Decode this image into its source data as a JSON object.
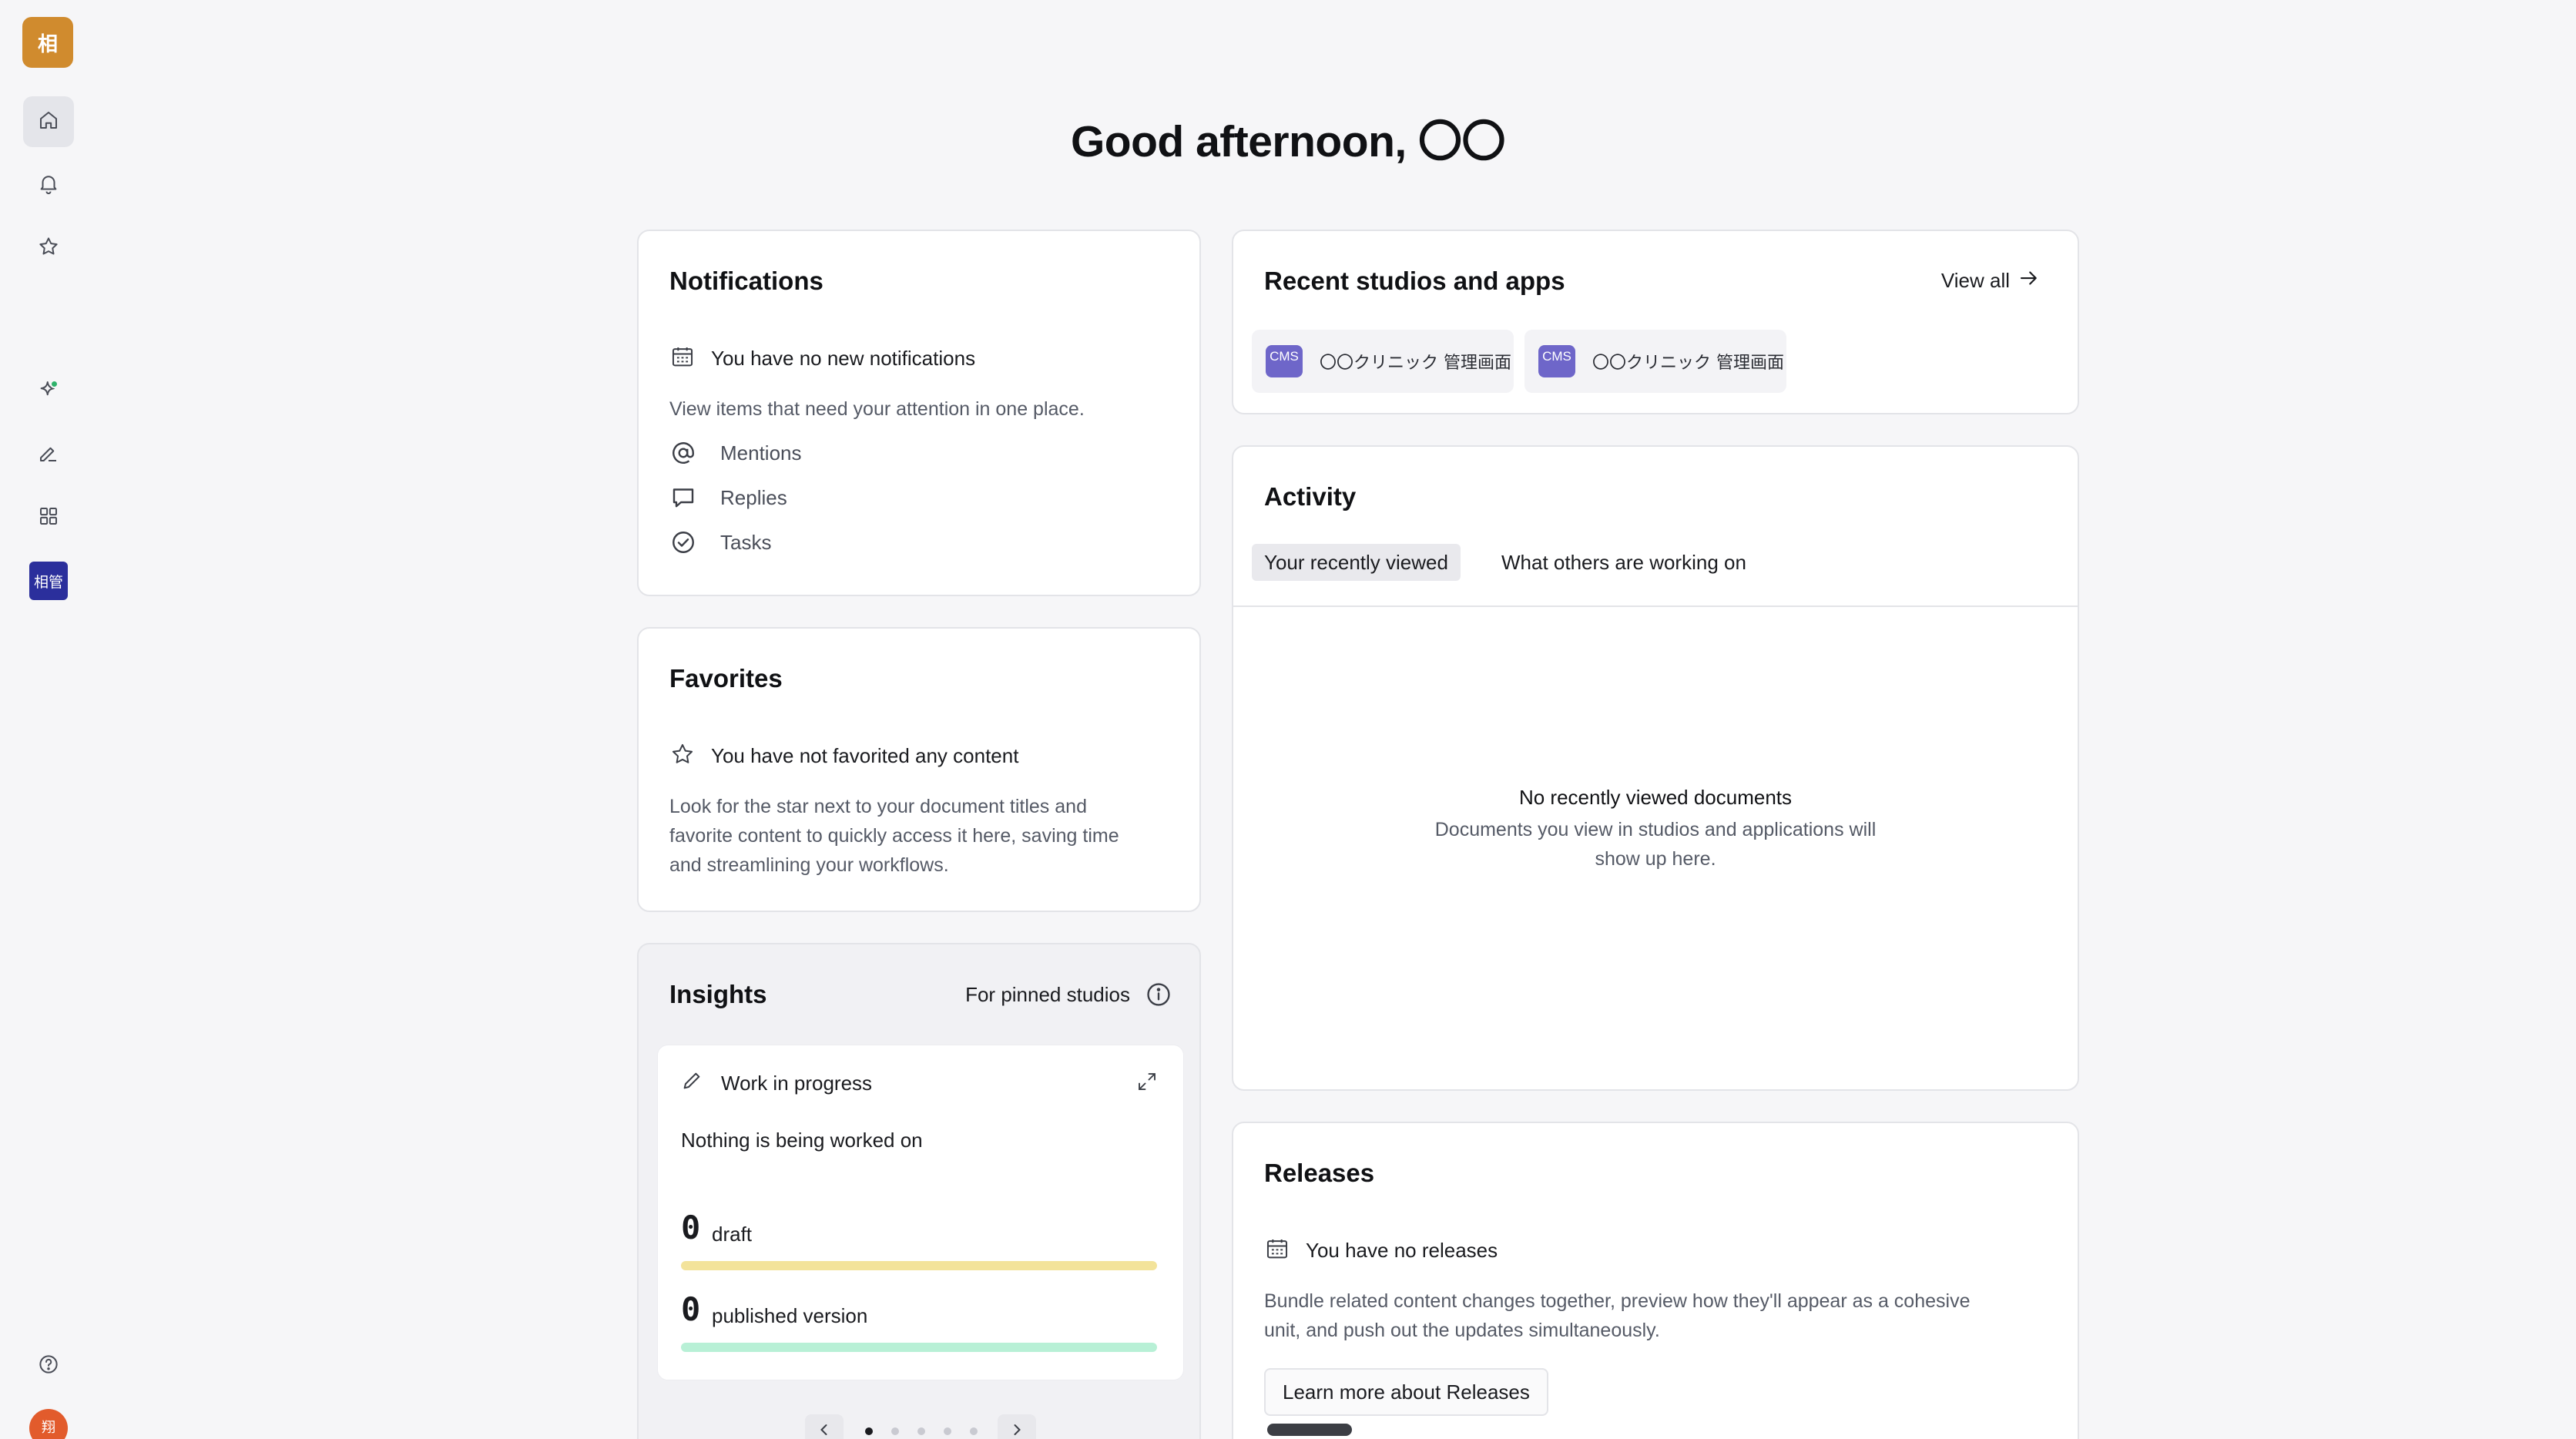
{
  "sidebar": {
    "workspace_initial": "相",
    "project_tile": "相管",
    "user_initial": "翔"
  },
  "greeting": "Good afternoon, 〇〇",
  "notifications": {
    "title": "Notifications",
    "empty_title": "You have no new notifications",
    "description": "View items that need your attention in one place.",
    "links": [
      "Mentions",
      "Replies",
      "Tasks"
    ]
  },
  "favorites": {
    "title": "Favorites",
    "empty_title": "You have not favorited any content",
    "description_lines": [
      "Look for the star next to your document titles and",
      "favorite content to quickly access it here, saving time",
      "and streamlining your workflows."
    ]
  },
  "insights": {
    "title": "Insights",
    "scope": "For pinned studios",
    "card_title": "Work in progress",
    "status": "Nothing is being worked on",
    "draft_count": "0",
    "draft_label": "draft",
    "published_count": "0",
    "published_label": "published version",
    "colors": {
      "draft_bar": "#f3e39a",
      "published_bar": "#b8f0d6"
    },
    "pager": {
      "total": 5,
      "current": 1
    }
  },
  "recent_studios": {
    "title": "Recent studios and apps",
    "view_all": "View all",
    "items": [
      {
        "badge": "CMS",
        "name": "〇〇クリニック 管理画面"
      },
      {
        "badge": "CMS",
        "name": "〇〇クリニック 管理画面"
      }
    ]
  },
  "activity": {
    "title": "Activity",
    "tabs": [
      {
        "label": "Your recently viewed",
        "active": true
      },
      {
        "label": "What others are working on",
        "active": false
      }
    ],
    "empty_title": "No recently viewed documents",
    "empty_line1": "Documents you view in studios and applications will",
    "empty_line2": "show up here."
  },
  "releases": {
    "title": "Releases",
    "empty_title": "You have no releases",
    "description_lines": [
      "Bundle related content changes together, preview how they'll appear as a cohesive",
      "unit, and push out the updates simultaneously."
    ],
    "button": "Learn more about Releases"
  }
}
